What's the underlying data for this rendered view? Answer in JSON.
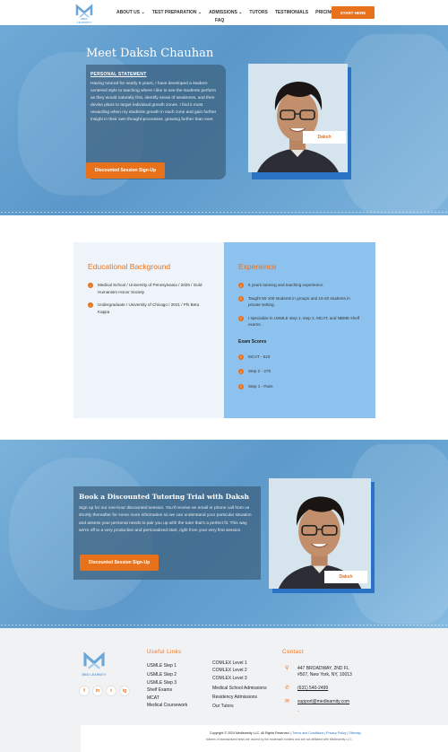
{
  "brand": {
    "name": "MED LEARNITY"
  },
  "nav": {
    "items": [
      "ABOUT US",
      "TEST PREPARATION",
      "ADMISSIONS",
      "TUTORS",
      "TESTIMONIALS",
      "PRICING"
    ],
    "second_row": "FAQ",
    "start_button": "START HERE"
  },
  "hero": {
    "title": "Meet Daksh Chauhan",
    "statement_heading": "PERSONAL STATEMENT",
    "statement": "Having tutored for nearly 5 years, I have developed a student-centered style to teaching where I like to see the students perform as they would naturally first, identify areas of weakness, and then devise plans to target individual growth zones. I find it most rewarding when my students growth in each zone and gain further insight in their own thought-processes, growing further than ever.",
    "button": "Discounted Session Sign-Up",
    "name_tag": "Daksh"
  },
  "education": {
    "title": "Educational Background",
    "items": [
      "Medical School / University of Pennsylvania / 2025 / Gold Humanism Honor Society",
      "Undergraduate / University of Chicago / 2021 / Phi Beta Kappa"
    ]
  },
  "experience": {
    "title": "Experience",
    "items": [
      "5 years tutoring and teaching experience.",
      "Taught 50-100 students in groups and 15-20 students in private setting.",
      "I specialize in USMLE step 1, step 2, MCAT, and NBME shelf exams."
    ],
    "exam_title": "Exam Scores",
    "scores": [
      "MCAT - 523",
      "Step 2 - 276",
      "Step 1 - Pass"
    ]
  },
  "cta": {
    "title": "Book a Discounted Tutoring Trial with Daksh",
    "text": "Sign up for our one-hour discounted session. You'll receive an email or phone call from us shortly thereafter for some more information so we can understand your particular situation and assess your personal needs to pair you up with the tutor that's a perfect fit. This way, we're off to a very productive and personalized start, right from your very first session.",
    "button": "Discounted Session Sign-Up",
    "name_tag": "Daksh"
  },
  "footer": {
    "useful_links_title": "Useful Links",
    "links_col1": [
      "USMLE Step 1",
      "USMLE Step 2",
      "USMLE Step 3",
      "Shelf Exams",
      "MCAT",
      "Medical Coursework"
    ],
    "links_col2": [
      "COMLEX Level 1",
      "COMLEX Level 2",
      "COMLEX Level 3",
      "Medical School Admissions",
      "Residency Admissions",
      "Our Tutors"
    ],
    "contact_title": "Contact",
    "address_line1": "447 BROADWAY, 2ND FL",
    "address_line2": "#507, New York, NY, 10013",
    "phone": "(631) 540-2499",
    "email": "support@medlearnity.com",
    "dash": "-",
    "socials": [
      "f",
      "in",
      "t",
      "ig"
    ],
    "copyright": "Copyright © 2024 Medlearnity LLC. All Rights Reserved. |",
    "copyright_links": "Terms and Conditions | Privacy Policy | Sitemap",
    "disclaimer": "Names of standardized tests are owned by the trademark holders and are not affiliated with Medlearnity LLC."
  },
  "colors": {
    "accent": "#e8721c",
    "blue": "#2a72c4",
    "hero": "#5b98c9"
  }
}
